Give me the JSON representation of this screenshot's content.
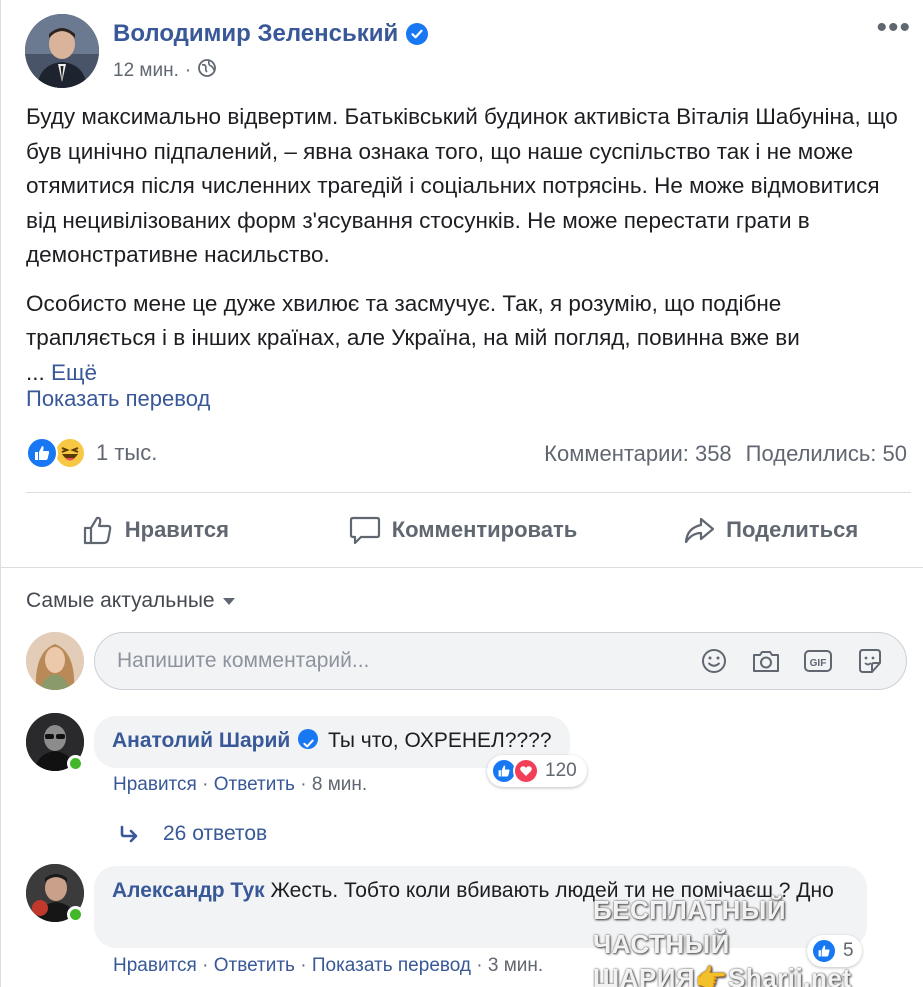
{
  "post": {
    "author": "Володимир Зеленський",
    "time": "12 мин.",
    "separator": "·",
    "more": "•••",
    "paragraph1": "Буду максимально відвертим. Батьківський будинок активіста Віталія Шабуніна, що був цинічно підпалений, – явна ознака того, що наше суспільство так і не може отямитися після численних трагедій і соціальних потрясінь. Не може відмовитися від нецивілізованих форм з'ясування стосунків. Не може перестати грати в демонстративне насильство.",
    "paragraph2": "Особисто мене це дуже хвилює та засмучує. Так, я розумію, що подібне трапляється і в інших країнах, але Україна, на мій погляд, повинна вже ви",
    "ellipsis": "...",
    "see_more": "Ещё",
    "translate": "Показать перевод",
    "reactions_count": "1 тыс.",
    "comments": "Комментарии: 358",
    "shares": "Поделились: 50"
  },
  "actions": {
    "like": "Нравится",
    "comment": "Комментировать",
    "share": "Поделиться"
  },
  "comments_section": {
    "sort_label": "Самые актуальные",
    "composer_placeholder": "Напишите комментарий..."
  },
  "comments": [
    {
      "author": "Анатолий Шарий",
      "text": "Ты что, ОХРЕНЕЛ????",
      "like": "Нравится",
      "reply": "Ответить",
      "time": "8 мин.",
      "reaction_count": "120",
      "replies": "26 ответов"
    },
    {
      "author": "Александр Тук",
      "text": "Жесть. Тобто коли вбивають людей ти не помічаєш ? Дно",
      "like": "Нравится",
      "reply": "Ответить",
      "translate": "Показать перевод",
      "time": "3 мин.",
      "reaction_count": "5"
    }
  ],
  "watermark": {
    "line1": "БЕСПЛАТНЫЙ ЧАСТНЫЙ",
    "line2": "ШАРИЯ👉Sharij.net"
  },
  "colors": {
    "link": "#385898",
    "facebook_blue": "#1877f2",
    "muted": "#606770",
    "bubble": "#f2f3f5",
    "online": "#42b72a"
  }
}
